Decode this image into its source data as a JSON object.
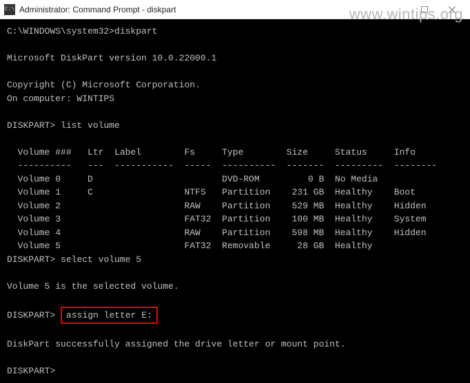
{
  "window": {
    "title": "Administrator: Command Prompt - diskpart",
    "icon_label": "cmd-icon"
  },
  "watermark": "www.wintips.org",
  "terminal": {
    "prompt1_path": "C:\\WINDOWS\\system32>",
    "prompt1_cmd": "diskpart",
    "version_line": "Microsoft DiskPart version 10.0.22000.1",
    "copyright": "Copyright (C) Microsoft Corporation.",
    "computer_line": "On computer: WINTIPS",
    "dp_prompt": "DISKPART>",
    "cmd_list": "list volume",
    "headers": {
      "volume": "Volume ###",
      "ltr": "Ltr",
      "label": "Label",
      "fs": "Fs",
      "type": "Type",
      "size": "Size",
      "status": "Status",
      "info": "Info"
    },
    "sep": {
      "volume": "----------",
      "ltr": "---",
      "label": "-----------",
      "fs": "-----",
      "type": "----------",
      "size": "-------",
      "status": "---------",
      "info": "--------"
    },
    "volumes": [
      {
        "num": "Volume 0",
        "ltr": "D",
        "label": "",
        "fs": "",
        "type": "DVD-ROM",
        "size": "0 B",
        "status": "No Media",
        "info": ""
      },
      {
        "num": "Volume 1",
        "ltr": "C",
        "label": "",
        "fs": "NTFS",
        "type": "Partition",
        "size": "231 GB",
        "status": "Healthy",
        "info": "Boot"
      },
      {
        "num": "Volume 2",
        "ltr": "",
        "label": "",
        "fs": "RAW",
        "type": "Partition",
        "size": "529 MB",
        "status": "Healthy",
        "info": "Hidden"
      },
      {
        "num": "Volume 3",
        "ltr": "",
        "label": "",
        "fs": "FAT32",
        "type": "Partition",
        "size": "100 MB",
        "status": "Healthy",
        "info": "System"
      },
      {
        "num": "Volume 4",
        "ltr": "",
        "label": "",
        "fs": "RAW",
        "type": "Partition",
        "size": "598 MB",
        "status": "Healthy",
        "info": "Hidden"
      },
      {
        "num": "Volume 5",
        "ltr": "",
        "label": "",
        "fs": "FAT32",
        "type": "Removable",
        "size": "28 GB",
        "status": "Healthy",
        "info": ""
      }
    ],
    "cmd_select": "select volume 5",
    "selected_msg": "Volume 5 is the selected volume.",
    "cmd_assign": "assign letter E:",
    "assign_msg": "DiskPart successfully assigned the drive letter or mount point."
  }
}
